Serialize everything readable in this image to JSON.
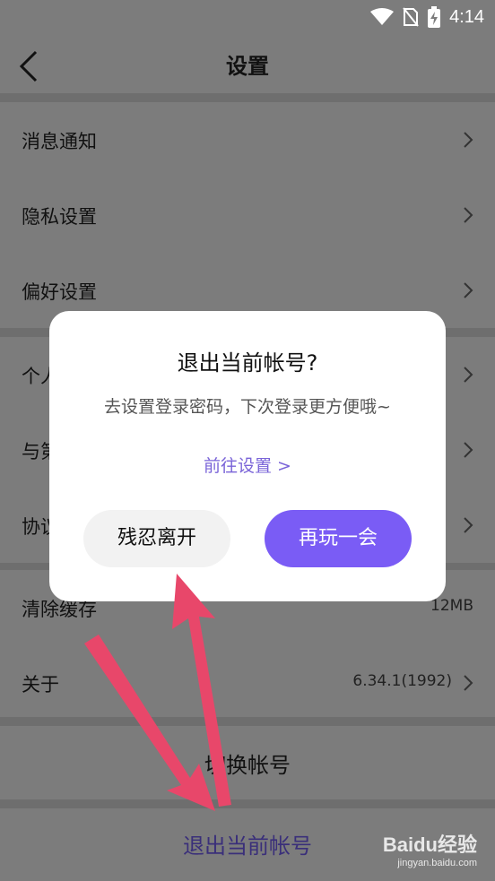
{
  "status_bar": {
    "time": "4:14"
  },
  "header": {
    "title": "设置"
  },
  "settings": {
    "group1": [
      {
        "label": "消息通知"
      },
      {
        "label": "隐私设置"
      },
      {
        "label": "偏好设置"
      }
    ],
    "group2": [
      {
        "label": "个人"
      },
      {
        "label": "与第"
      },
      {
        "label": "协议"
      }
    ],
    "group3": [
      {
        "label": "清除缓存",
        "value": "12MB"
      },
      {
        "label": "关于",
        "value": "6.34.1(1992)"
      }
    ],
    "switch_account": "切换帐号",
    "logout": "退出当前帐号"
  },
  "dialog": {
    "title": "退出当前帐号?",
    "subtitle": "去设置登录密码，下次登录更方便哦~",
    "link": "前往设置 >",
    "leave_button": "残忍离开",
    "stay_button": "再玩一会"
  },
  "watermark": {
    "logo": "Baidu经验",
    "url": "jingyan.baidu.com"
  },
  "colors": {
    "accent": "#7a5cf5",
    "link": "#7a64d8",
    "overlay": "#7c7c7c",
    "arrow": "#e8476a"
  }
}
